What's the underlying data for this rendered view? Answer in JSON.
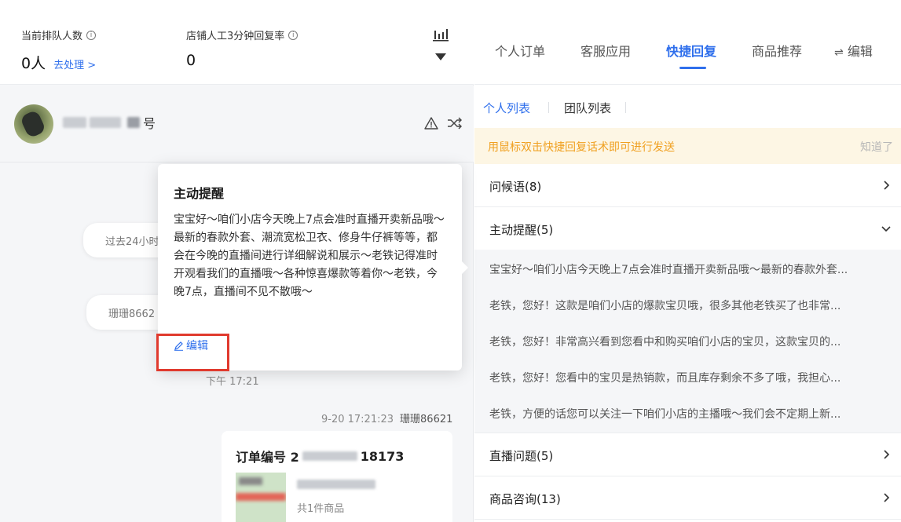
{
  "stats": {
    "queue_label": "当前排队人数",
    "queue_value": "0人",
    "queue_action": "去处理 >",
    "reply_rate_label": "店铺人工3分钟回复率",
    "reply_rate_value": "0"
  },
  "chat": {
    "username_visible": "号",
    "bubble1_text": "过去24小时",
    "bubble2_text": "珊珊8662",
    "time1": "下午 17:21",
    "time2_date": "9-20 17:21:23",
    "time2_name": "珊珊86621",
    "order_title_prefix": "订单编号 2",
    "order_title_suffix": "18173",
    "order_sub": "共1件商品"
  },
  "popover": {
    "title": "主动提醒",
    "body": "宝宝好～咱们小店今天晚上7点会准时直播开卖新品哦～最新的春款外套、潮流宽松卫衣、修身牛仔裤等等，都会在今晚的直播间进行详细解说和展示～老铁记得准时开观看我们的直播哦～各种惊喜爆款等着你～老铁，今晚7点，直播间不见不散哦～",
    "edit_label": "编辑"
  },
  "right": {
    "tabs": [
      "个人订单",
      "客服应用",
      "快捷回复",
      "商品推荐",
      "编辑"
    ],
    "active_tab": "快捷回复",
    "subtabs": [
      "个人列表",
      "团队列表"
    ],
    "notice": "用鼠标双击快捷回复话术即可进行发送",
    "notice_dismiss": "知道了",
    "categories": [
      {
        "name": "问候语(8)",
        "expanded": false
      },
      {
        "name": "主动提醒(5)",
        "expanded": true
      },
      {
        "name": "直播问题(5)",
        "expanded": false
      },
      {
        "name": "商品咨询(13)",
        "expanded": false
      }
    ],
    "reminder_items": [
      "宝宝好～咱们小店今天晚上7点会准时直播开卖新品哦～最新的春款外套...",
      "老铁，您好！这款是咱们小店的爆款宝贝哦，很多其他老铁买了也非常...",
      "老铁，您好！非常高兴看到您看中和购买咱们小店的宝贝，这款宝贝的...",
      "老铁，您好！您看中的宝贝是热销款，而且库存剩余不多了哦，我担心...",
      "老铁，方便的话您可以关注一下咱们小店的主播哦～我们会不定期上新..."
    ]
  },
  "colors": {
    "accent": "#2f6fec",
    "notice_bg": "#fdf6e4",
    "notice_text": "#f0a020",
    "highlight": "#e03a2e"
  }
}
